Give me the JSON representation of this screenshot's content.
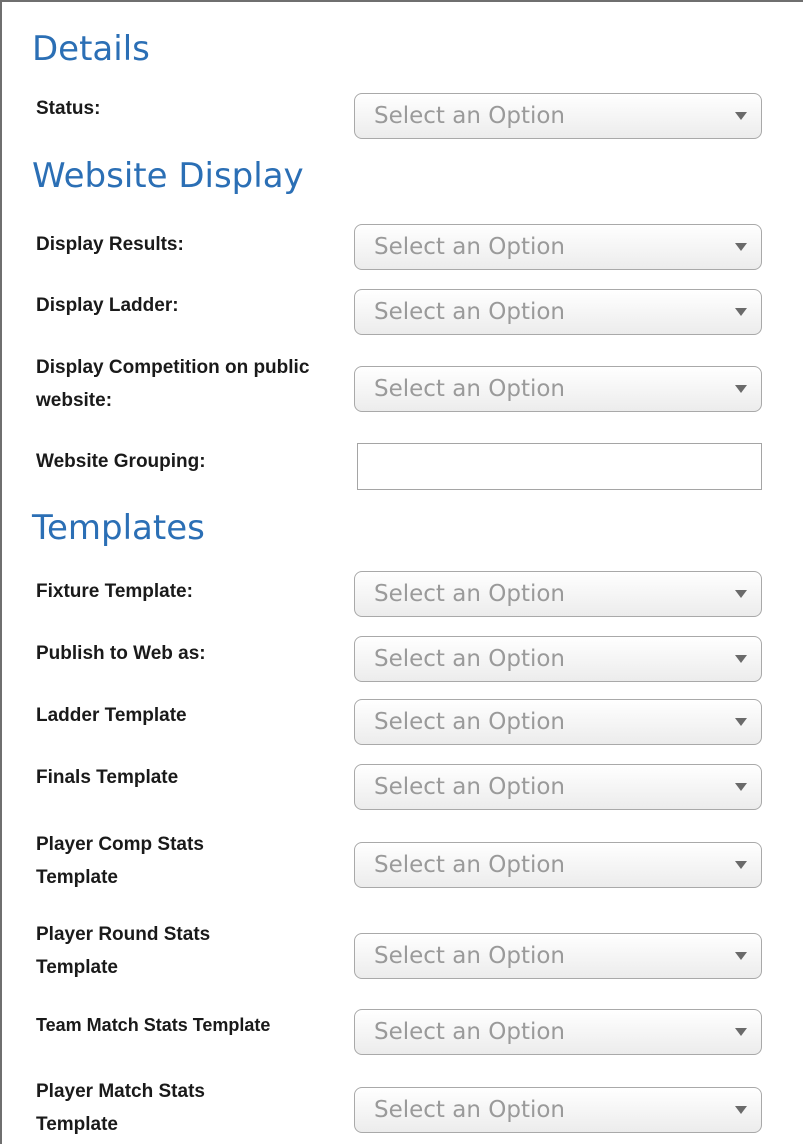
{
  "details": {
    "heading": "Details",
    "status": {
      "label": "Status:",
      "value": "Select an Option"
    }
  },
  "website_display": {
    "heading": "Website Display",
    "display_results": {
      "label": "Display Results:",
      "value": "Select an Option"
    },
    "display_ladder": {
      "label": "Display Ladder:",
      "value": "Select an Option"
    },
    "display_competition": {
      "label": "Display Competition on public website:",
      "value": "Select an Option"
    },
    "website_grouping": {
      "label": "Website Grouping:",
      "value": ""
    }
  },
  "templates": {
    "heading": "Templates",
    "fixture_template": {
      "label": "Fixture Template:",
      "value": "Select an Option"
    },
    "publish_to_web": {
      "label": "Publish to Web as:",
      "value": "Select an Option"
    },
    "ladder_template": {
      "label": "Ladder Template",
      "value": "Select an Option"
    },
    "finals_template": {
      "label": "Finals Template",
      "value": "Select an Option"
    },
    "player_comp_stats": {
      "label": "Player Comp Stats Template",
      "value": "Select an Option"
    },
    "player_round_stats": {
      "label": "Player Round Stats Template",
      "value": "Select an Option"
    },
    "team_match_stats": {
      "label": "Team Match Stats Template",
      "value": "Select an Option"
    },
    "player_match_stats": {
      "label": "Player Match Stats Template",
      "value": "Select an Option"
    }
  }
}
